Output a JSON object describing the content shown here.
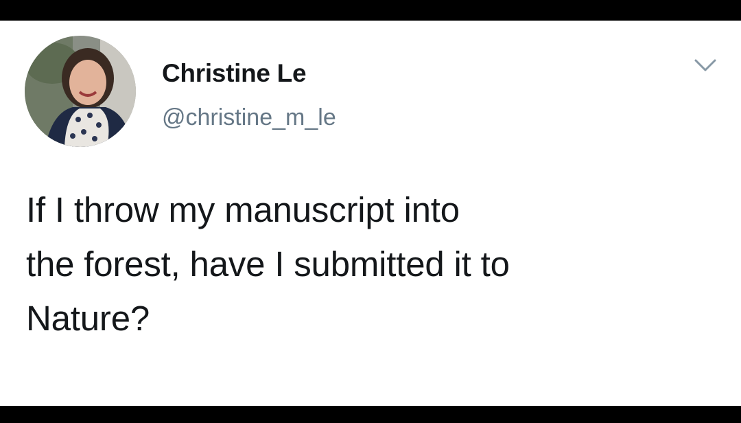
{
  "tweet": {
    "author": {
      "name": "Christine Le",
      "handle": "@christine_m_le",
      "avatar_icon": "profile-photo"
    },
    "menu_icon": "chevron-down-icon",
    "text_lines": [
      "If I throw my manuscript into",
      "the forest, have I submitted it to",
      "Nature?"
    ]
  },
  "colors": {
    "background": "#ffffff",
    "frame": "#000000",
    "name_text": "#14171a",
    "handle_text": "#657786",
    "caret": "#8899a6"
  }
}
